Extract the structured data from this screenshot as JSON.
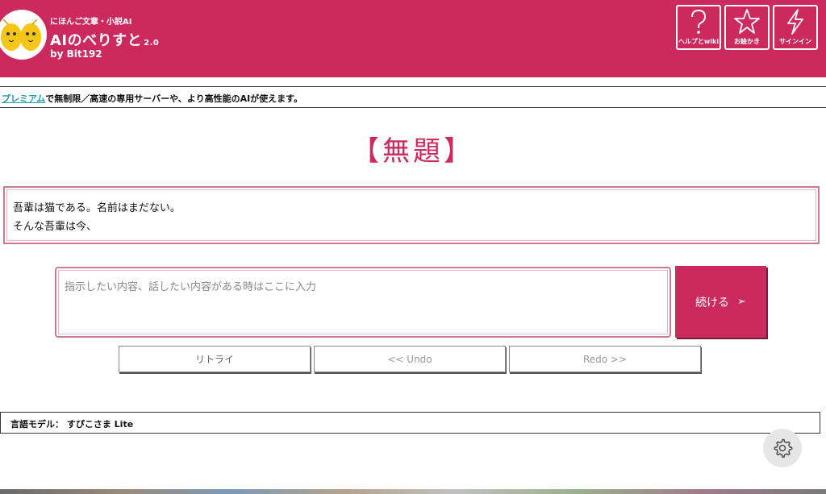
{
  "header": {
    "tagline": "にほんご文章・小説AI",
    "title": "AIのべりすと",
    "version": "2.0",
    "by": "by Bit192",
    "buttons": {
      "help": "ヘルプとwiki",
      "omakase": "お絵かき",
      "signin": "サインイン"
    }
  },
  "premium": {
    "link": "プレミアム",
    "text": "で無制限／高速の専用サーバーや、より高性能のAIが使えます。"
  },
  "document": {
    "title": "【無題】",
    "lines": [
      "吾輩は猫である。名前はまだない。",
      "そんな吾輩は今、"
    ]
  },
  "input": {
    "placeholder": "指示したい内容、話したい内容がある時はここに入力",
    "value": ""
  },
  "actions": {
    "continue": "続ける",
    "continue_arrow": "➢",
    "retry": "リトライ",
    "undo": "<< Undo",
    "redo": "Redo >>"
  },
  "model": {
    "label": "言語モデル：",
    "name": "すぴこさま Lite"
  },
  "icons": {
    "help": "question-icon",
    "omakase": "star-icon",
    "signin": "lightning-icon",
    "settings": "gear-icon"
  },
  "colors": {
    "brand": "#cc2a5c",
    "link": "#1a9cae",
    "border_pink": "#cc7a98"
  }
}
